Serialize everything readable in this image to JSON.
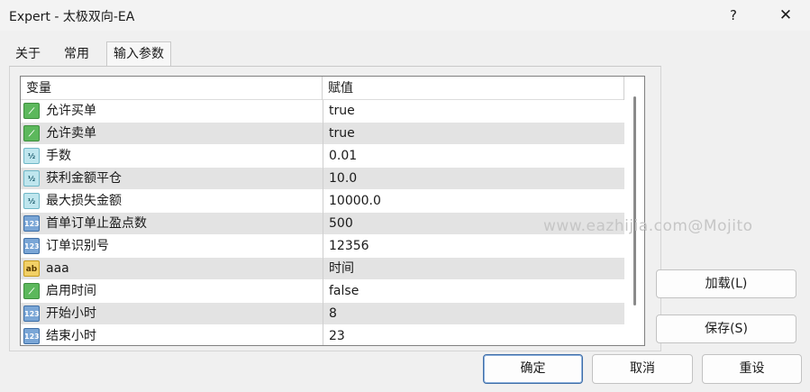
{
  "window": {
    "title": "Expert - 太极双向-EA",
    "help_label": "?",
    "close_label": "✕"
  },
  "tabs": [
    {
      "label": "关于"
    },
    {
      "label": "常用"
    },
    {
      "label": "输入参数"
    }
  ],
  "grid": {
    "headers": {
      "variable": "变量",
      "value": "赋值"
    },
    "rows": [
      {
        "icon": "bool-type-icon",
        "type_label": "⟋",
        "name": "允许买单",
        "value": "true"
      },
      {
        "icon": "bool-type-icon",
        "type_label": "⟋",
        "name": "允许卖单",
        "value": "true"
      },
      {
        "icon": "double-type-icon",
        "type_label": "½",
        "name": "手数",
        "value": "0.01"
      },
      {
        "icon": "double-type-icon",
        "type_label": "½",
        "name": "获利金额平仓",
        "value": "10.0"
      },
      {
        "icon": "double-type-icon",
        "type_label": "½",
        "name": "最大损失金额",
        "value": "10000.0"
      },
      {
        "icon": "int-type-icon",
        "type_label": "123",
        "name": "首单订单止盈点数",
        "value": "500"
      },
      {
        "icon": "int-type-icon",
        "type_label": "123",
        "name": "订单识别号",
        "value": "12356"
      },
      {
        "icon": "string-type-icon",
        "type_label": "ab",
        "name": "aaa",
        "value": "时间"
      },
      {
        "icon": "bool-type-icon",
        "type_label": "⟋",
        "name": "启用时间",
        "value": "false"
      },
      {
        "icon": "int-type-icon",
        "type_label": "123",
        "name": "开始小时",
        "value": "8"
      },
      {
        "icon": "int-type-icon",
        "type_label": "123",
        "name": "结束小时",
        "value": "23"
      }
    ]
  },
  "watermark": "www.eazhijia.com@Mojito",
  "side_buttons": {
    "load_label": "加载(L)",
    "save_label": "保存(S)"
  },
  "footer_buttons": {
    "ok_label": "确定",
    "cancel_label": "取消",
    "reset_label": "重设"
  }
}
